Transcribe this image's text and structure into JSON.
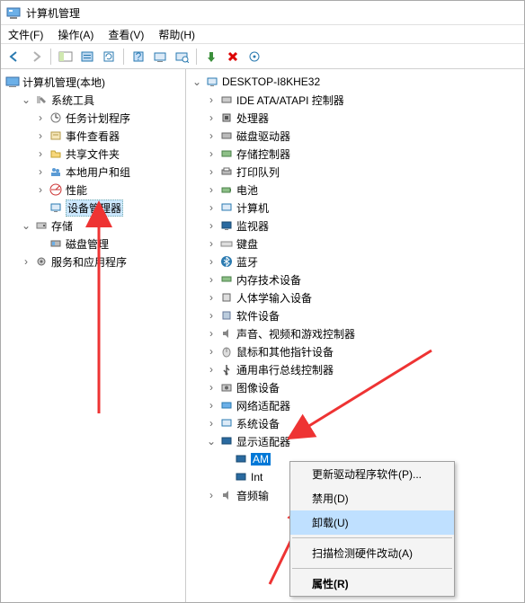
{
  "window": {
    "title": "计算机管理"
  },
  "menu": {
    "file": "文件(F)",
    "action": "操作(A)",
    "view": "查看(V)",
    "help": "帮助(H)"
  },
  "left": {
    "root": "计算机管理(本地)",
    "system_tools": "系统工具",
    "task_scheduler": "任务计划程序",
    "event_viewer": "事件查看器",
    "shared_folders": "共享文件夹",
    "local_users": "本地用户和组",
    "performance": "性能",
    "device_manager": "设备管理器",
    "storage": "存储",
    "disk_mgmt": "磁盘管理",
    "services_apps": "服务和应用程序"
  },
  "right": {
    "host": "DESKTOP-I8KHE32",
    "ide": "IDE ATA/ATAPI 控制器",
    "cpu": "处理器",
    "disk": "磁盘驱动器",
    "storage": "存储控制器",
    "print": "打印队列",
    "battery": "电池",
    "computer": "计算机",
    "monitor": "监视器",
    "keyboard": "键盘",
    "bluetooth": "蓝牙",
    "memory": "内存技术设备",
    "hid": "人体学输入设备",
    "software": "软件设备",
    "sound": "声音、视频和游戏控制器",
    "mouse": "鼠标和其他指针设备",
    "usb": "通用串行总线控制器",
    "image": "图像设备",
    "net": "网络适配器",
    "sysdev": "系统设备",
    "display": "显示适配器",
    "gpu_amd_prefix": "AM",
    "gpu_intel_prefix": "Int",
    "audio": "音频输"
  },
  "context": {
    "update": "更新驱动程序软件(P)...",
    "disable": "禁用(D)",
    "uninstall": "卸载(U)",
    "scan": "扫描检测硬件改动(A)",
    "properties": "属性(R)"
  },
  "expander": {
    "open": "⌄",
    "closed": "›"
  }
}
